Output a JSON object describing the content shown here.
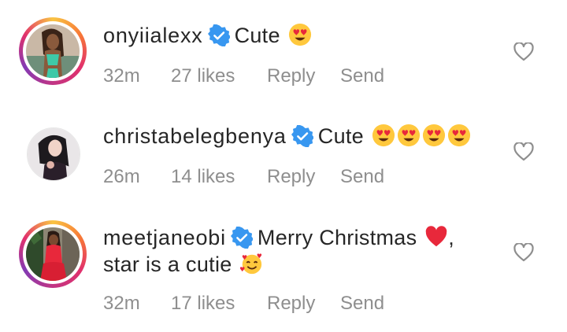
{
  "comments": [
    {
      "username": "onyiialexx",
      "text": "Cute",
      "emojis": [
        "heart-eyes"
      ],
      "time": "32m",
      "likes": "27 likes",
      "reply_label": "Reply",
      "send_label": "Send"
    },
    {
      "username": "christabelegbenya",
      "text": "Cute",
      "emojis": [
        "heart-eyes",
        "heart-eyes",
        "heart-eyes",
        "heart-eyes"
      ],
      "time": "26m",
      "likes": "14 likes",
      "reply_label": "Reply",
      "send_label": "Send"
    },
    {
      "username": "meetjaneobi",
      "text": "Merry Christmas",
      "text_end": ",",
      "text_line2": "star is a cutie",
      "emojis": [
        "red-heart",
        "smiling-face-with-hearts"
      ],
      "time": "32m",
      "likes": "17 likes",
      "reply_label": "Reply",
      "send_label": "Send"
    }
  ],
  "colors": {
    "verified_blue": "#3897f0",
    "meta_gray": "#8e8e8e",
    "text": "#262626"
  }
}
